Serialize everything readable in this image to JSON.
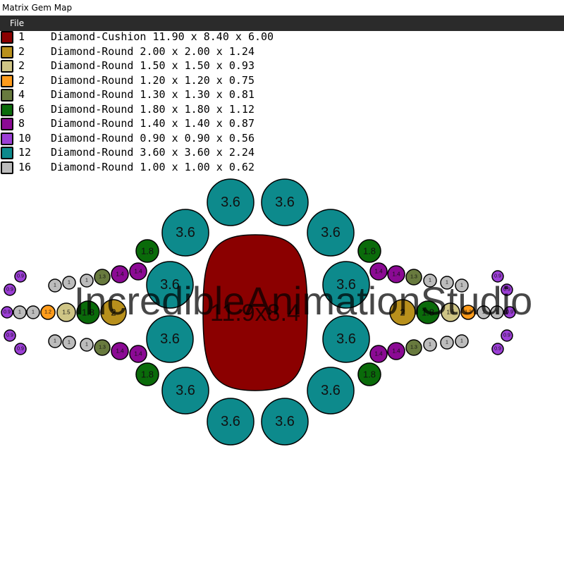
{
  "window": {
    "title": "Matrix Gem Map"
  },
  "menu": {
    "file_label": "File"
  },
  "legend": [
    {
      "color": "#8b0000",
      "count": "1",
      "description": "Diamond-Cushion 11.90 x 8.40 x 6.00"
    },
    {
      "color": "#b8901c",
      "count": "2",
      "description": "Diamond-Round 2.00 x 2.00 x 1.24"
    },
    {
      "color": "#cfc586",
      "count": "2",
      "description": "Diamond-Round 1.50 x 1.50 x 0.93"
    },
    {
      "color": "#ff9c1c",
      "count": "2",
      "description": "Diamond-Round 1.20 x 1.20 x 0.75"
    },
    {
      "color": "#687a3e",
      "count": "4",
      "description": "Diamond-Round 1.30 x 1.30 x 0.81"
    },
    {
      "color": "#0a6b0a",
      "count": "6",
      "description": "Diamond-Round 1.80 x 1.80 x 1.12"
    },
    {
      "color": "#8b0a94",
      "count": "8",
      "description": "Diamond-Round 1.40 x 1.40 x 0.87"
    },
    {
      "color": "#9c3fd6",
      "count": "10",
      "description": "Diamond-Round 0.90 x 0.90 x 0.56"
    },
    {
      "color": "#0d8a8c",
      "count": "12",
      "description": "Diamond-Round 3.60 x 3.60 x 2.24"
    },
    {
      "color": "#bcbcbc",
      "count": "16",
      "description": "Diamond-Round 1.00 x 1.00 x 0.62"
    }
  ],
  "gem_map": {
    "center_stone_label": "11.9x8.4",
    "watermark": "IncredibleAnimationStudio",
    "gems": [
      {
        "label": "3.6",
        "color": "#0d8a8c"
      },
      {
        "label": "2",
        "color": "#b8901c"
      },
      {
        "label": "1.5",
        "color": "#cfc586"
      },
      {
        "label": "1.2",
        "color": "#ff9c1c"
      },
      {
        "label": "1.3",
        "color": "#687a3e"
      },
      {
        "label": "1.8",
        "color": "#0a6b0a"
      },
      {
        "label": "1.4",
        "color": "#8b0a94"
      },
      {
        "label": "0.9",
        "color": "#9c3fd6"
      },
      {
        "label": "1",
        "color": "#bcbcbc"
      }
    ]
  }
}
